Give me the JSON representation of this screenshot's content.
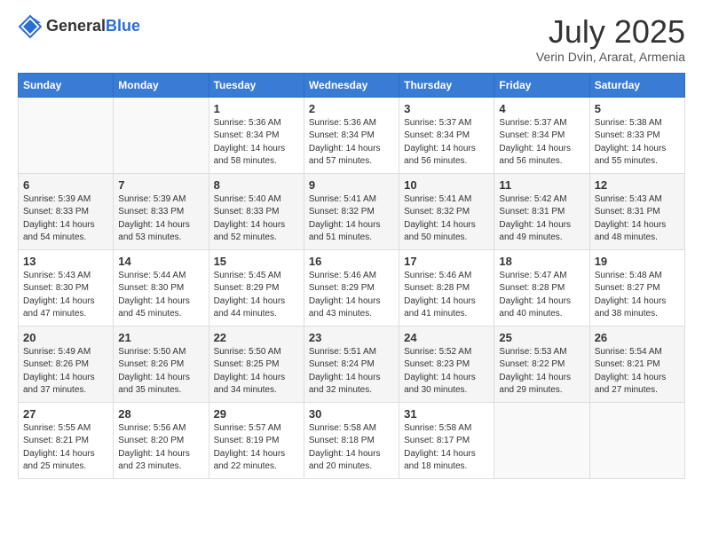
{
  "header": {
    "logo_general": "General",
    "logo_blue": "Blue",
    "title": "July 2025",
    "subtitle": "Verin Dvin, Ararat, Armenia"
  },
  "calendar": {
    "days_of_week": [
      "Sunday",
      "Monday",
      "Tuesday",
      "Wednesday",
      "Thursday",
      "Friday",
      "Saturday"
    ],
    "weeks": [
      [
        {
          "day": "",
          "info": ""
        },
        {
          "day": "",
          "info": ""
        },
        {
          "day": "1",
          "info": "Sunrise: 5:36 AM\nSunset: 8:34 PM\nDaylight: 14 hours\nand 58 minutes."
        },
        {
          "day": "2",
          "info": "Sunrise: 5:36 AM\nSunset: 8:34 PM\nDaylight: 14 hours\nand 57 minutes."
        },
        {
          "day": "3",
          "info": "Sunrise: 5:37 AM\nSunset: 8:34 PM\nDaylight: 14 hours\nand 56 minutes."
        },
        {
          "day": "4",
          "info": "Sunrise: 5:37 AM\nSunset: 8:34 PM\nDaylight: 14 hours\nand 56 minutes."
        },
        {
          "day": "5",
          "info": "Sunrise: 5:38 AM\nSunset: 8:33 PM\nDaylight: 14 hours\nand 55 minutes."
        }
      ],
      [
        {
          "day": "6",
          "info": "Sunrise: 5:39 AM\nSunset: 8:33 PM\nDaylight: 14 hours\nand 54 minutes."
        },
        {
          "day": "7",
          "info": "Sunrise: 5:39 AM\nSunset: 8:33 PM\nDaylight: 14 hours\nand 53 minutes."
        },
        {
          "day": "8",
          "info": "Sunrise: 5:40 AM\nSunset: 8:33 PM\nDaylight: 14 hours\nand 52 minutes."
        },
        {
          "day": "9",
          "info": "Sunrise: 5:41 AM\nSunset: 8:32 PM\nDaylight: 14 hours\nand 51 minutes."
        },
        {
          "day": "10",
          "info": "Sunrise: 5:41 AM\nSunset: 8:32 PM\nDaylight: 14 hours\nand 50 minutes."
        },
        {
          "day": "11",
          "info": "Sunrise: 5:42 AM\nSunset: 8:31 PM\nDaylight: 14 hours\nand 49 minutes."
        },
        {
          "day": "12",
          "info": "Sunrise: 5:43 AM\nSunset: 8:31 PM\nDaylight: 14 hours\nand 48 minutes."
        }
      ],
      [
        {
          "day": "13",
          "info": "Sunrise: 5:43 AM\nSunset: 8:30 PM\nDaylight: 14 hours\nand 47 minutes."
        },
        {
          "day": "14",
          "info": "Sunrise: 5:44 AM\nSunset: 8:30 PM\nDaylight: 14 hours\nand 45 minutes."
        },
        {
          "day": "15",
          "info": "Sunrise: 5:45 AM\nSunset: 8:29 PM\nDaylight: 14 hours\nand 44 minutes."
        },
        {
          "day": "16",
          "info": "Sunrise: 5:46 AM\nSunset: 8:29 PM\nDaylight: 14 hours\nand 43 minutes."
        },
        {
          "day": "17",
          "info": "Sunrise: 5:46 AM\nSunset: 8:28 PM\nDaylight: 14 hours\nand 41 minutes."
        },
        {
          "day": "18",
          "info": "Sunrise: 5:47 AM\nSunset: 8:28 PM\nDaylight: 14 hours\nand 40 minutes."
        },
        {
          "day": "19",
          "info": "Sunrise: 5:48 AM\nSunset: 8:27 PM\nDaylight: 14 hours\nand 38 minutes."
        }
      ],
      [
        {
          "day": "20",
          "info": "Sunrise: 5:49 AM\nSunset: 8:26 PM\nDaylight: 14 hours\nand 37 minutes."
        },
        {
          "day": "21",
          "info": "Sunrise: 5:50 AM\nSunset: 8:26 PM\nDaylight: 14 hours\nand 35 minutes."
        },
        {
          "day": "22",
          "info": "Sunrise: 5:50 AM\nSunset: 8:25 PM\nDaylight: 14 hours\nand 34 minutes."
        },
        {
          "day": "23",
          "info": "Sunrise: 5:51 AM\nSunset: 8:24 PM\nDaylight: 14 hours\nand 32 minutes."
        },
        {
          "day": "24",
          "info": "Sunrise: 5:52 AM\nSunset: 8:23 PM\nDaylight: 14 hours\nand 30 minutes."
        },
        {
          "day": "25",
          "info": "Sunrise: 5:53 AM\nSunset: 8:22 PM\nDaylight: 14 hours\nand 29 minutes."
        },
        {
          "day": "26",
          "info": "Sunrise: 5:54 AM\nSunset: 8:21 PM\nDaylight: 14 hours\nand 27 minutes."
        }
      ],
      [
        {
          "day": "27",
          "info": "Sunrise: 5:55 AM\nSunset: 8:21 PM\nDaylight: 14 hours\nand 25 minutes."
        },
        {
          "day": "28",
          "info": "Sunrise: 5:56 AM\nSunset: 8:20 PM\nDaylight: 14 hours\nand 23 minutes."
        },
        {
          "day": "29",
          "info": "Sunrise: 5:57 AM\nSunset: 8:19 PM\nDaylight: 14 hours\nand 22 minutes."
        },
        {
          "day": "30",
          "info": "Sunrise: 5:58 AM\nSunset: 8:18 PM\nDaylight: 14 hours\nand 20 minutes."
        },
        {
          "day": "31",
          "info": "Sunrise: 5:58 AM\nSunset: 8:17 PM\nDaylight: 14 hours\nand 18 minutes."
        },
        {
          "day": "",
          "info": ""
        },
        {
          "day": "",
          "info": ""
        }
      ]
    ]
  }
}
